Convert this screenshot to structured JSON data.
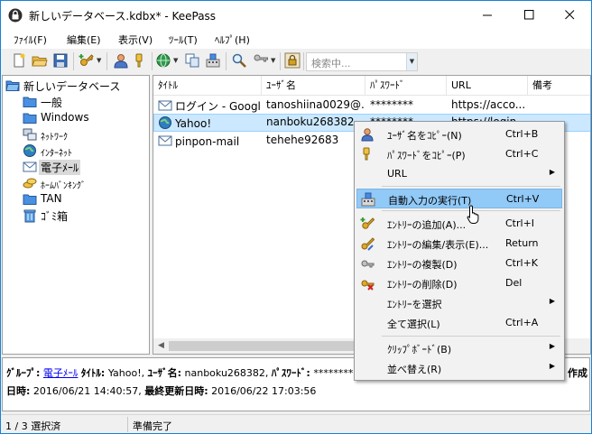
{
  "window": {
    "title": "新しいデータベース.kdbx* - KeePass",
    "controls": {
      "minimize": "minimize",
      "maximize": "maximize",
      "close": "close"
    }
  },
  "menu": [
    "ﾌｧｲﾙ(F)",
    "編集(E)",
    "表示(V)",
    "ﾂｰﾙ(T)",
    "ﾍﾙﾌﾟ(H)"
  ],
  "toolbar": {
    "search_placeholder": "検索中..."
  },
  "tree": {
    "root": "新しいデータベース",
    "groups": [
      {
        "label": "一般",
        "icon": "folder-icon"
      },
      {
        "label": "Windows",
        "icon": "folder-icon"
      },
      {
        "label": "ﾈｯﾄﾜｰｸ",
        "icon": "network-icon"
      },
      {
        "label": "ｲﾝﾀｰﾈｯﾄ",
        "icon": "globe-icon"
      },
      {
        "label": "電子ﾒｰﾙ",
        "icon": "envelope-icon"
      },
      {
        "label": "ﾎｰﾑﾊﾞﾝｷﾝｸﾞ",
        "icon": "coins-icon"
      },
      {
        "label": "TAN",
        "icon": "folder-icon"
      },
      {
        "label": "ｺﾞﾐ箱",
        "icon": "recycle-bin-icon"
      }
    ],
    "selected_index": 4
  },
  "list": {
    "columns": [
      "ﾀｲﾄﾙ",
      "ﾕｰｻﾞ名",
      "ﾊﾟｽﾜｰﾄﾞ",
      "URL",
      "備考"
    ],
    "rows": [
      {
        "title": "ログイン - Googl...",
        "user": "tanoshiina0029@...",
        "password": "********",
        "url": "https://acco...",
        "notes": ""
      },
      {
        "title": "Yahoo!",
        "user": "nanboku268382",
        "password": "********",
        "url": "https://login...",
        "notes": ""
      },
      {
        "title": "pinpon-mail",
        "user": "tehehe92683",
        "password": "",
        "url": "",
        "notes": ""
      }
    ],
    "selected_index": 1
  },
  "details": {
    "group_label": "ｸﾞﾙｰﾌﾟ:",
    "group_value": "電子ﾒｰﾙ",
    "title_label": "ﾀｲﾄﾙ:",
    "title_value": "Yahoo!,",
    "user_label": "ﾕｰｻﾞ名:",
    "user_value": "nanboku268382,",
    "password_label": "ﾊﾟｽﾜｰﾄﾞ:",
    "password_value": "********,",
    "created_suffix": "作成",
    "line2_label1": "日時:",
    "line2_value1": "2016/06/21 14:40:57,",
    "line2_label2": "最終更新日時:",
    "line2_value2": "2016/06/22 17:03:56"
  },
  "status": {
    "selection": "1 / 3 選択済",
    "state": "準備完了"
  },
  "context_menu": [
    {
      "label": "ﾕｰｻﾞ名をｺﾋﾟｰ(N)",
      "shortcut": "Ctrl+B",
      "icon": "user-icon",
      "submenu": false
    },
    {
      "label": "ﾊﾟｽﾜｰﾄﾞをｺﾋﾟｰ(P)",
      "shortcut": "Ctrl+C",
      "icon": "key-icon",
      "submenu": false
    },
    {
      "label": "URL",
      "shortcut": "",
      "icon": "",
      "submenu": true
    },
    {
      "label": "自動入力の実行(T)",
      "shortcut": "Ctrl+V",
      "icon": "autotype-icon",
      "submenu": false
    },
    {
      "label": "ｴﾝﾄﾘｰの追加(A)...",
      "shortcut": "Ctrl+I",
      "icon": "add-entry-icon",
      "submenu": false
    },
    {
      "label": "ｴﾝﾄﾘｰの編集/表示(E)...",
      "shortcut": "Return",
      "icon": "edit-entry-icon",
      "submenu": false
    },
    {
      "label": "ｴﾝﾄﾘｰの複製(D)",
      "shortcut": "Ctrl+K",
      "icon": "duplicate-entry-icon",
      "submenu": false
    },
    {
      "label": "ｴﾝﾄﾘｰの削除(D)",
      "shortcut": "Del",
      "icon": "delete-entry-icon",
      "submenu": false
    },
    {
      "label": "ｴﾝﾄﾘｰを選択",
      "shortcut": "",
      "icon": "",
      "submenu": true
    },
    {
      "label": "全て選択(L)",
      "shortcut": "Ctrl+A",
      "icon": "",
      "submenu": false
    },
    {
      "label": "ｸﾘｯﾌﾟﾎﾞｰﾄﾞ(B)",
      "shortcut": "",
      "icon": "",
      "submenu": true
    },
    {
      "label": "並べ替え(R)",
      "shortcut": "",
      "icon": "",
      "submenu": true
    }
  ],
  "context_highlight_index": 3
}
